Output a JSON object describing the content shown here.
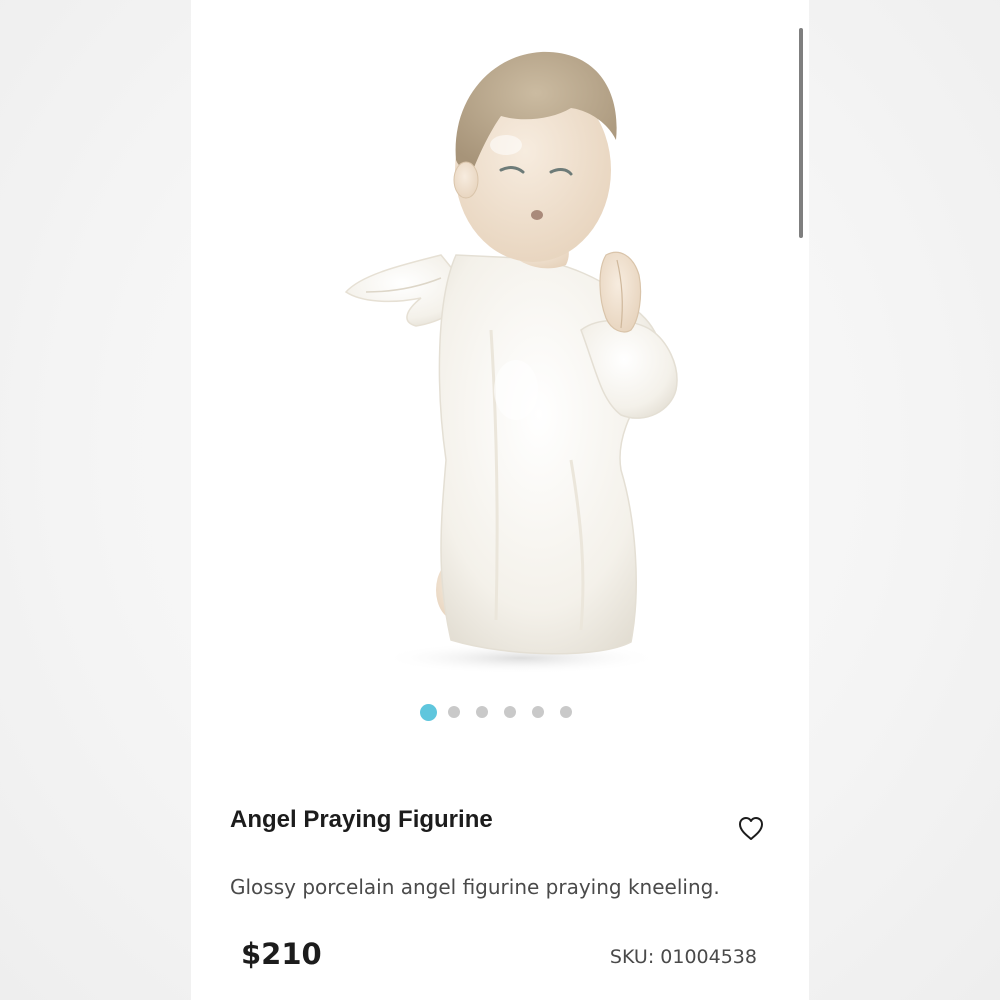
{
  "product": {
    "title": "Angel Praying Figurine",
    "description": "Glossy porcelain angel figurine praying kneeling.",
    "price": "$210",
    "sku": "SKU: 01004538",
    "image_subject": "porcelain kneeling praying angel figurine"
  },
  "carousel": {
    "total": 6,
    "active_index": 0
  },
  "icons": {
    "favorite": "heart-outline-icon"
  },
  "colors": {
    "accent": "#5fc6dd",
    "dot_inactive": "#c9c9c9",
    "text_primary": "#1c1c1c",
    "text_secondary": "#4a4a4a"
  }
}
